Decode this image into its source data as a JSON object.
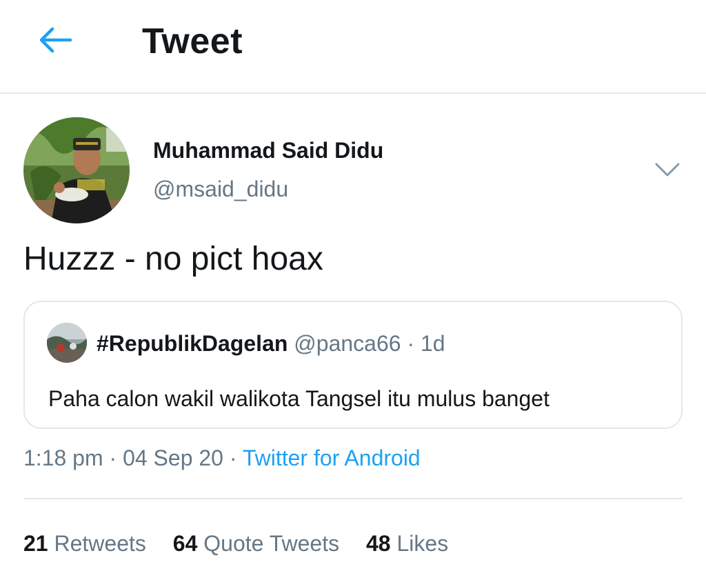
{
  "header": {
    "title": "Tweet",
    "back_icon": "arrow-left-icon"
  },
  "colors": {
    "accent": "#1da1f2",
    "secondary_text": "#657786",
    "primary_text": "#14171a",
    "border": "#e1e8ed"
  },
  "tweet": {
    "display_name": "Muhammad Said Didu",
    "handle": "@msaid_didu",
    "text": "Huzzz - no pict hoax",
    "caret_icon": "chevron-down-icon",
    "time": "1:18 pm",
    "date": "04 Sep 20",
    "source": "Twitter for Android",
    "separator": "·"
  },
  "quote": {
    "display_name": "#RepublikDagelan",
    "handle": "@panca66",
    "age": "1d",
    "separator": "·",
    "text": "Paha calon wakil walikota Tangsel itu mulus banget"
  },
  "stats": [
    {
      "count": "21",
      "label": "Retweets"
    },
    {
      "count": "64",
      "label": "Quote Tweets"
    },
    {
      "count": "48",
      "label": "Likes"
    }
  ]
}
